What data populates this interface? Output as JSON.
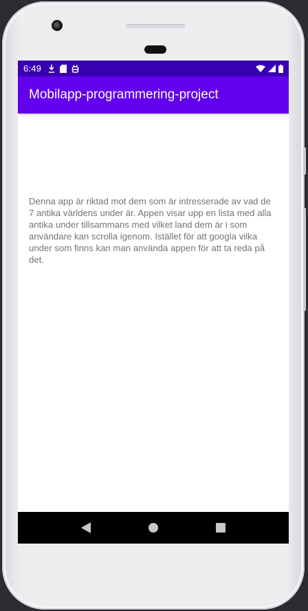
{
  "status_bar": {
    "time": "6:49",
    "left_icons": [
      "download-icon",
      "sd-card-icon",
      "android-debug-icon"
    ],
    "right_icons": [
      "wifi-icon",
      "cell-signal-icon",
      "battery-icon"
    ]
  },
  "app_bar": {
    "title": "Mobilapp-programmering-project"
  },
  "main": {
    "description": "Denna app är riktad mot dem som är intresserade av vad de 7 antika världens under är. Appen visar upp en lista med alla antika under tillsammans med vilket land dem är i som användare kan scrolla igenom. Istället för att googla vilka under som finns kan man använda appen för att ta reda på det."
  },
  "nav_bar": {
    "buttons": [
      "back-icon",
      "home-icon",
      "recents-icon"
    ]
  },
  "colors": {
    "status_bar": "#3700b3",
    "app_bar": "#6200ee",
    "nav_bar": "#000000",
    "body_text": "#737373"
  }
}
